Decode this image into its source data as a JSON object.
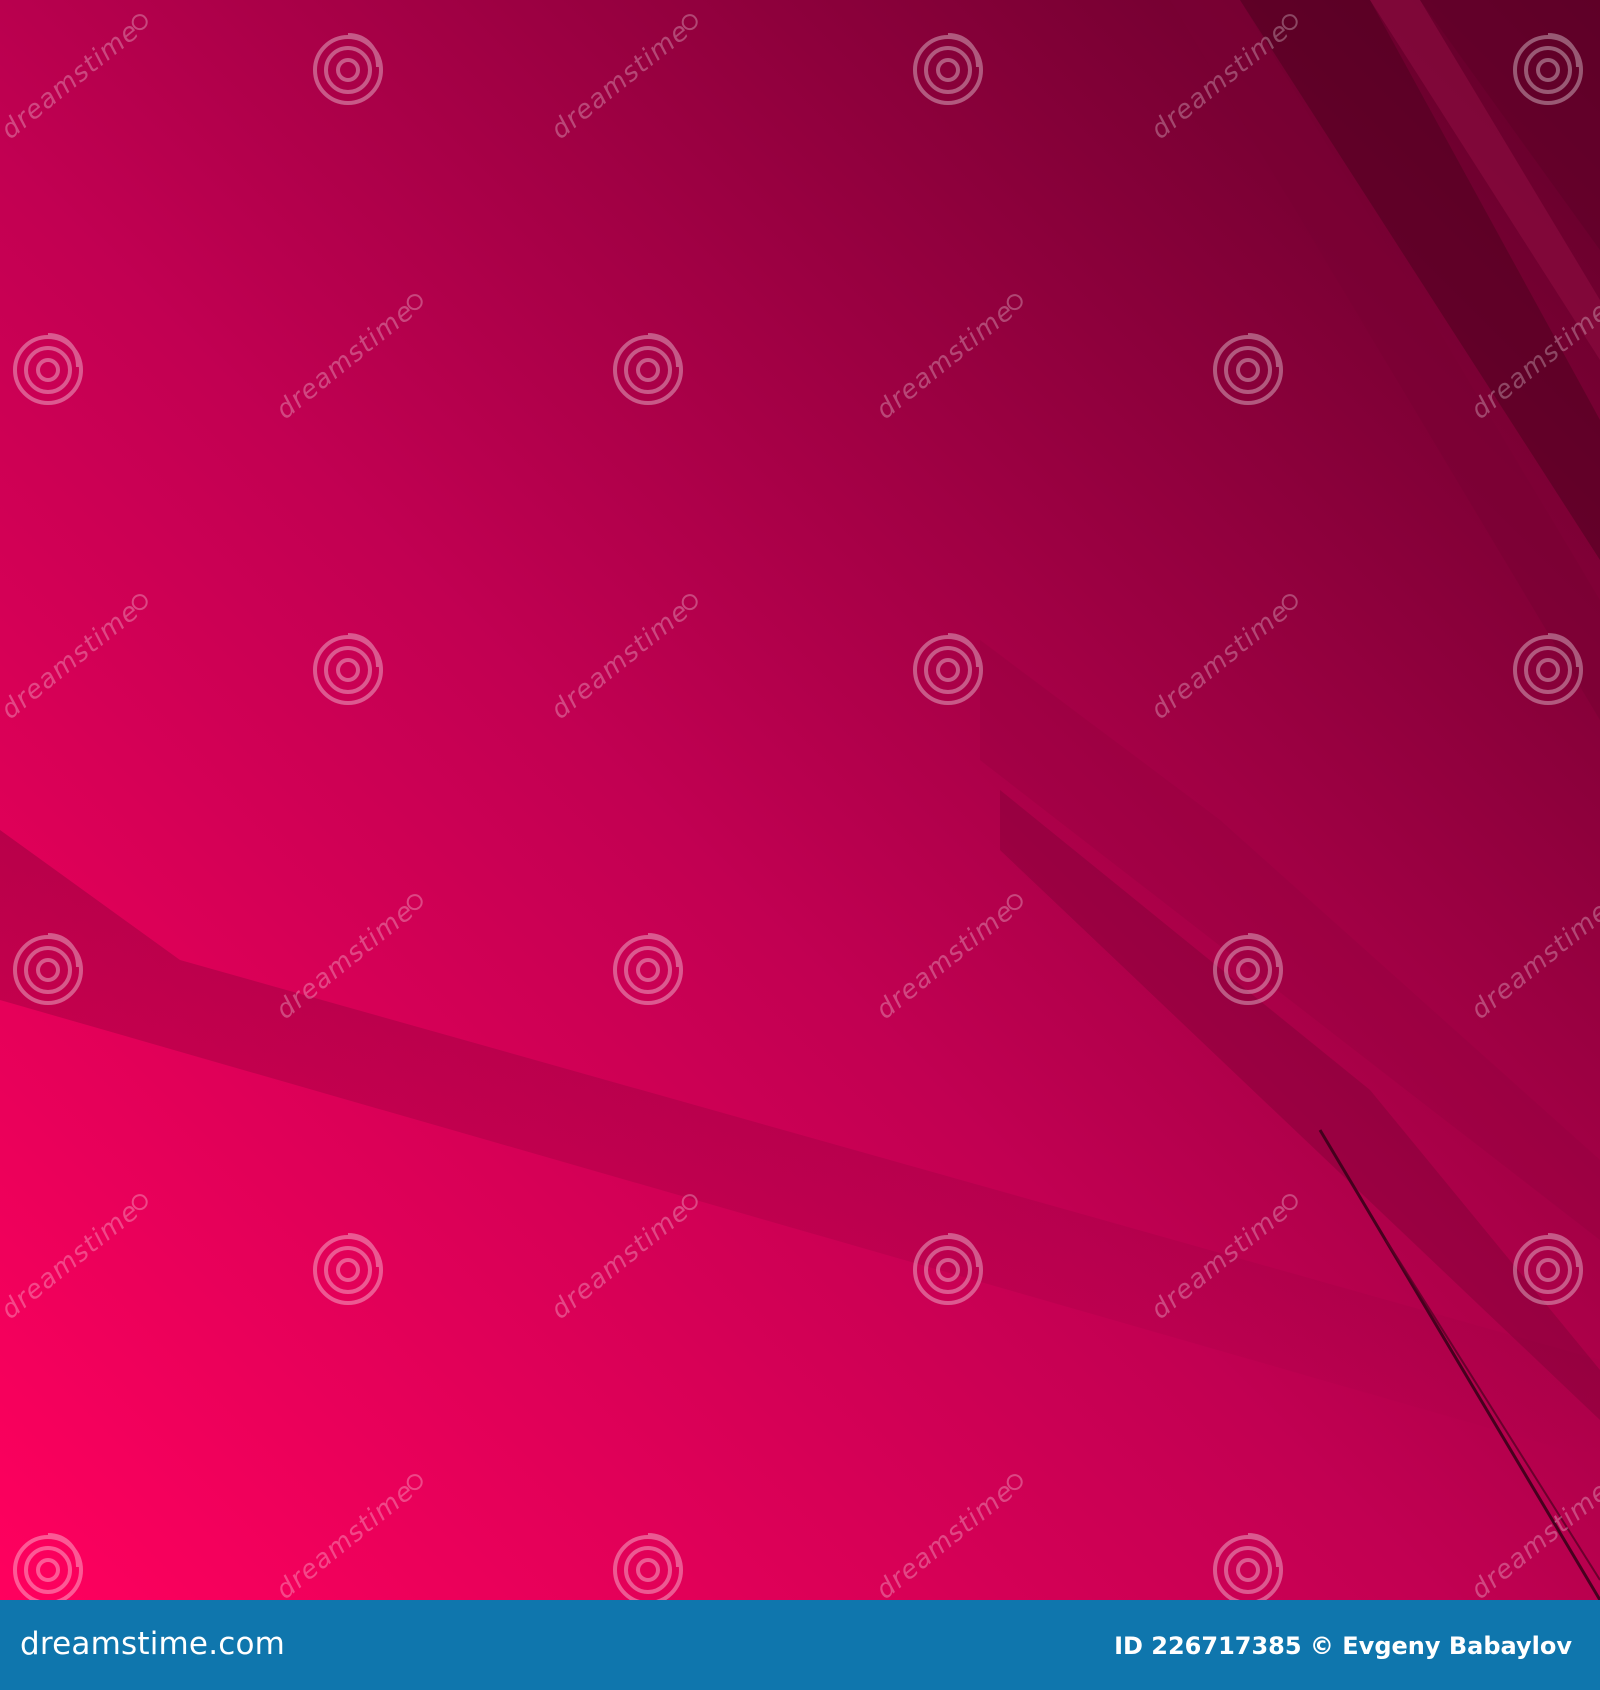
{
  "image": {
    "colors": {
      "light": "#ff005e",
      "mid": "#c20052",
      "dark": "#5f0028",
      "darkest": "#45001f"
    }
  },
  "watermark": {
    "text": "dreamstime",
    "color": "#ffffff"
  },
  "footer": {
    "brand": "dreamstime.com",
    "credit": "ID 226717385 © Evgeny Babaylov",
    "background": "#0f76ad"
  }
}
